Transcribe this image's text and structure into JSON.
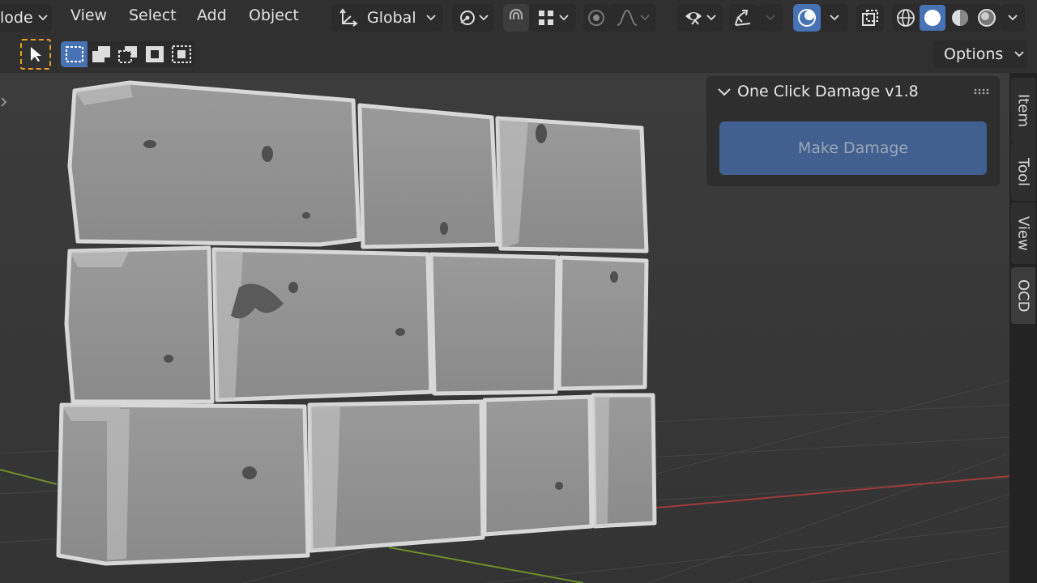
{
  "header": {
    "mode_label": "lode",
    "menus": [
      "View",
      "Select",
      "Add",
      "Object"
    ],
    "orientation_label": "Global"
  },
  "icons": {
    "orientation": "transform-orientation-icon",
    "pivot": "pivot-point-icon",
    "snap": "magnet-icon",
    "snap_target": "snap-increment-icon",
    "proportional": "proportional-editing-icon",
    "falloff": "falloff-curve-icon",
    "visibility": "eye-icon",
    "gizmo": "gizmo-icon",
    "overlays": "overlays-icon",
    "xray": "xray-icon",
    "shading_wire": "wireframe-shading-icon",
    "shading_solid": "solid-shading-icon",
    "shading_material": "material-shading-icon",
    "shading_rendered": "rendered-shading-icon",
    "select_tool": "cursor-icon"
  },
  "toolbar": {
    "options_label": "Options"
  },
  "panel": {
    "title": "One Click Damage v1.8",
    "button_label": "Make Damage"
  },
  "side_tabs": [
    "Item",
    "Tool",
    "View",
    "OCD"
  ],
  "colors": {
    "accent": "#4772b3",
    "button": "#41608f",
    "viewport": "#393939",
    "x_axis": "#9b3b3b",
    "y_axis": "#6f8f2a"
  }
}
